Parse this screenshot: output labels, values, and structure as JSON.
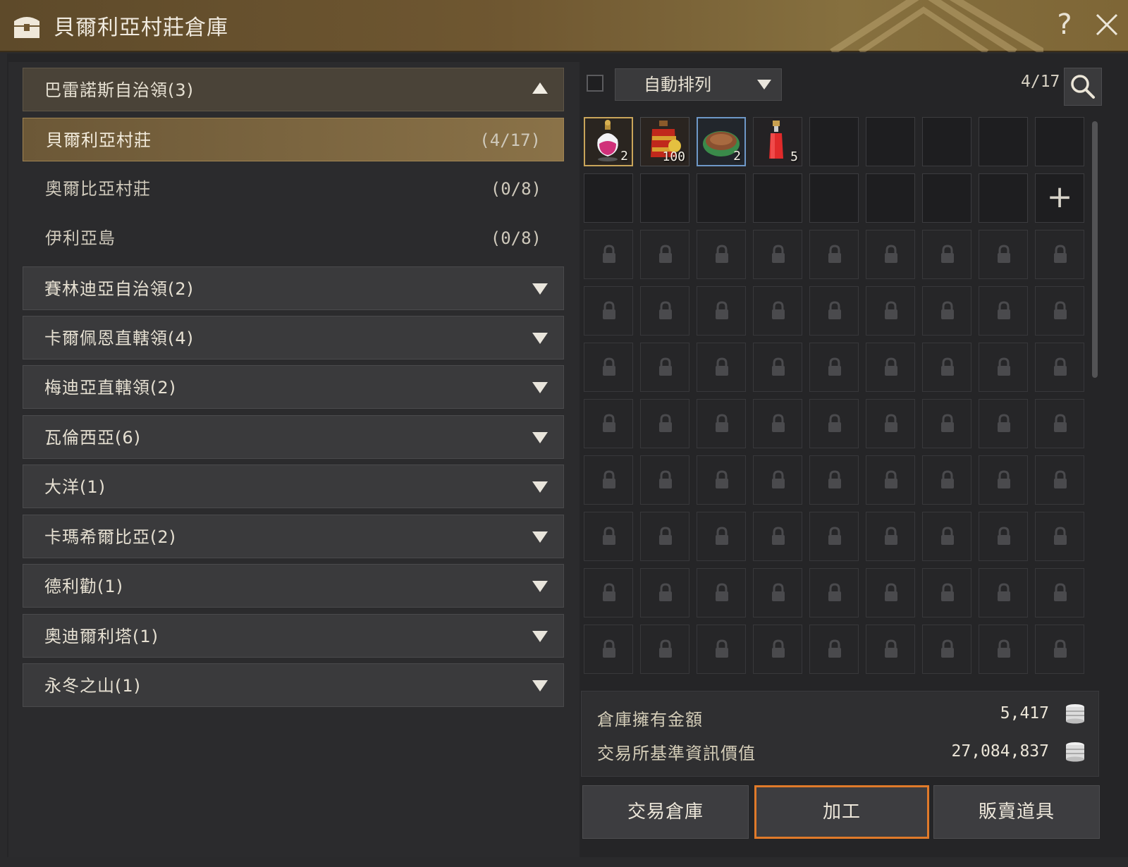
{
  "window": {
    "title": "貝爾利亞村莊倉庫",
    "help_label": "?",
    "title_icon": "chest-icon",
    "close_icon": "close-icon"
  },
  "regions": [
    {
      "label": "巴雷諾斯自治領(3)",
      "expanded": true
    },
    {
      "label": "賽林迪亞自治領(2)",
      "expanded": false
    },
    {
      "label": "卡爾佩恩直轄領(4)",
      "expanded": false
    },
    {
      "label": "梅迪亞直轄領(2)",
      "expanded": false
    },
    {
      "label": "瓦倫西亞(6)",
      "expanded": false
    },
    {
      "label": "大洋(1)",
      "expanded": false
    },
    {
      "label": "卡瑪希爾比亞(2)",
      "expanded": false
    },
    {
      "label": "德利勸(1)",
      "expanded": false
    },
    {
      "label": "奧迪爾利塔(1)",
      "expanded": false
    },
    {
      "label": "永冬之山(1)",
      "expanded": false
    }
  ],
  "towns": [
    {
      "name": "貝爾利亞村莊",
      "count": "(4/17)",
      "selected": true
    },
    {
      "name": "奧爾比亞村莊",
      "count": "(0/8)",
      "selected": false
    },
    {
      "name": "伊利亞島",
      "count": "(0/8)",
      "selected": false
    }
  ],
  "toolbar": {
    "sort_label": "自動排列",
    "capacity": "4/17"
  },
  "inventory": {
    "columns": 9,
    "rows": 10,
    "unlocked_slots": 17,
    "items": [
      {
        "icon": "perfume-potion-icon",
        "qty": "2"
      },
      {
        "icon": "lantern-bundle-icon",
        "qty": "100"
      },
      {
        "icon": "food-bowl-icon",
        "qty": "2"
      },
      {
        "icon": "red-potion-icon",
        "qty": "5"
      }
    ],
    "expand_label": "+"
  },
  "money": {
    "storage_label": "倉庫擁有金額",
    "storage_value": "5,417",
    "market_label": "交易所基準資訊價值",
    "market_value": "27,084,837"
  },
  "buttons": {
    "trade_storage": "交易倉庫",
    "process": "加工",
    "sell_items": "販賣道具"
  },
  "colors": {
    "title_bar": "#6f5731",
    "selected_row": "#8a7248",
    "highlight_border": "#e07a2a"
  }
}
